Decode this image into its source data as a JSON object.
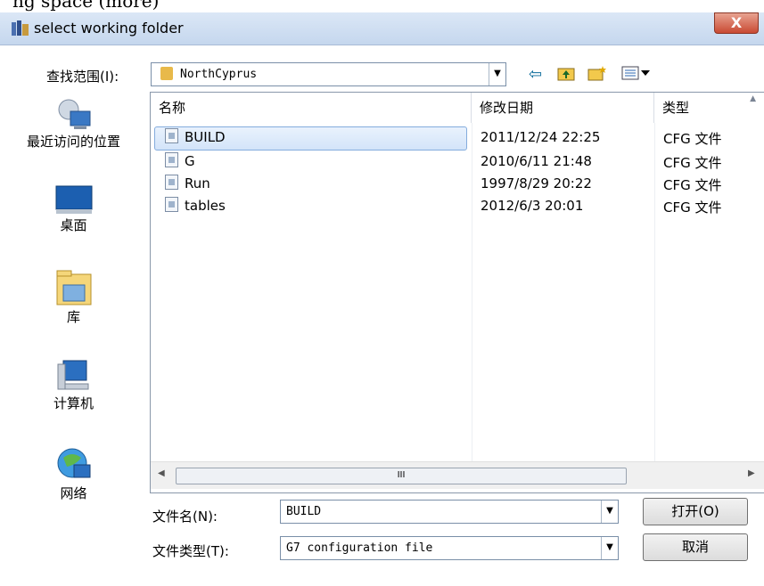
{
  "caption": {
    "text": "ng space (more)"
  },
  "window": {
    "title": "select working folder",
    "close_label": "X"
  },
  "lookin": {
    "label": "查找范围(I):",
    "value": "NorthCyprus"
  },
  "places": [
    {
      "label": "最近访问的位置"
    },
    {
      "label": "桌面"
    },
    {
      "label": "库"
    },
    {
      "label": "计算机"
    },
    {
      "label": "网络"
    }
  ],
  "columns": {
    "name": "名称",
    "date": "修改日期",
    "type": "类型"
  },
  "files": [
    {
      "name": "BUILD",
      "date": "2011/12/24 22:25",
      "type": "CFG 文件"
    },
    {
      "name": "G",
      "date": "2010/6/11 21:48",
      "type": "CFG 文件"
    },
    {
      "name": "Run",
      "date": "1997/8/29 20:22",
      "type": "CFG 文件"
    },
    {
      "name": "tables",
      "date": "2012/6/3 20:01",
      "type": "CFG 文件"
    }
  ],
  "scroll": {
    "thumb_glyph": "III"
  },
  "filename": {
    "label": "文件名(N):",
    "value": "BUILD"
  },
  "filetype": {
    "label": "文件类型(T):",
    "value": "G7 configuration file"
  },
  "buttons": {
    "open": "打开(O)",
    "cancel": "取消"
  },
  "colors": {
    "accent": "#0a6a9a",
    "selection": "#dce9f9"
  }
}
